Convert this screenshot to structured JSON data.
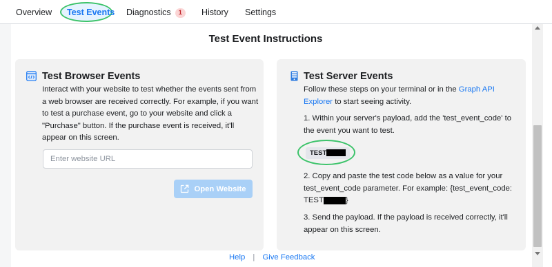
{
  "tabs": [
    {
      "label": "Overview"
    },
    {
      "label": "Test Events",
      "active": true
    },
    {
      "label": "Diagnostics",
      "badge": "1"
    },
    {
      "label": "History"
    },
    {
      "label": "Settings"
    }
  ],
  "section_title": "Test Event Instructions",
  "browser_panel": {
    "title": "Test Browser Events",
    "icon": "code-window-icon",
    "description": "Interact with your website to test whether the events sent from a web browser are received correctly. For example, if you want to test a purchase event, go to your website and click a \"Purchase\" button. If the purchase event is received, it'll appear on this screen.",
    "url_placeholder": "Enter website URL",
    "url_value": "",
    "open_button_label": "Open Website",
    "open_button_icon": "external-link-icon"
  },
  "server_panel": {
    "title": "Test Server Events",
    "icon": "server-icon",
    "intro_before_link": "Follow these steps on your terminal or in the ",
    "intro_link": "Graph API Explorer",
    "intro_after_link": " to start seeing activity.",
    "step1": "1. Within your server's payload, add the 'test_event_code' to the event you want to test.",
    "test_code": "TEST",
    "step2_text": "2. Copy and paste the test code below as a value for your test_event_code parameter. For example: {test_event_code:",
    "step2_code": "TEST",
    "step2_close": "}",
    "step3": "3. Send the payload. If the payload is received correctly, it'll appear on this screen."
  },
  "footer": {
    "help": "Help",
    "separator": "|",
    "feedback": "Give Feedback"
  },
  "colors": {
    "accent": "#1877f2",
    "panel_bg": "#f2f2f2",
    "disabled_button": "#a9d0f7",
    "highlight_ring": "#3cc36a",
    "badge_bg": "#fbd5d5",
    "badge_text": "#c0262b"
  }
}
